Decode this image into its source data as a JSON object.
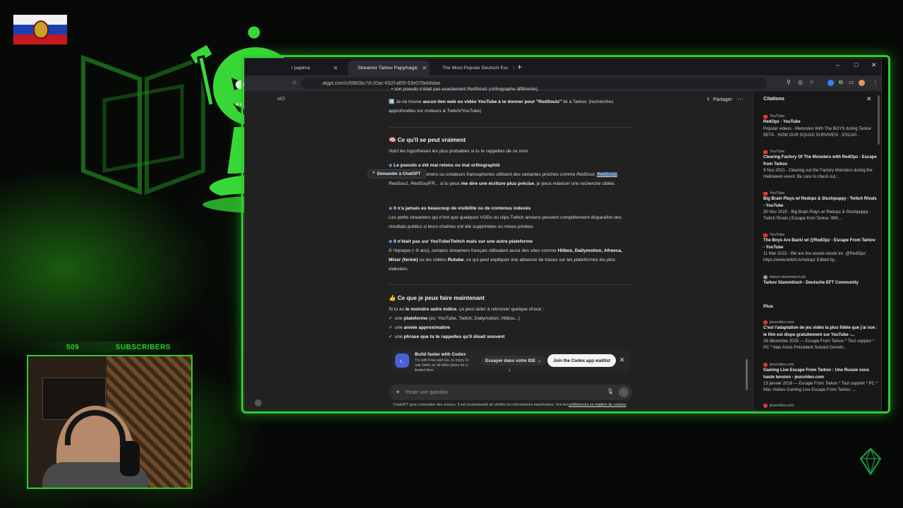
{
  "overlay": {
    "subscriber_count": "509",
    "subscriber_label": "SUBSCRIBERS",
    "accent_color": "#2bd12b"
  },
  "browser": {
    "tabs": [
      {
        "label": "r papima",
        "active": false
      },
      {
        "label": "Streamer Tarkov Papymagic",
        "active": true
      },
      {
        "label": "The Most Popular Deutsch Esc",
        "active": false
      }
    ],
    "url": "atgpt.com/c/6982bc7d-20ac-832f-af05-53e070eb6dae",
    "window_controls": [
      "–",
      "□",
      "✕"
    ]
  },
  "chat": {
    "share_label": "Partager",
    "partial_top_text": "son pseudo n'était pas exactement RedSoulz (orthographe différente).",
    "notice": {
      "prefix": "Je ne trouve ",
      "bold": "aucun lien web ou vidéo YouTube à te donner pour \"RedSoulz\"",
      "rest": " lié à Tarkov. (recherches approfondies sur moteurs & Twitch/YouTube)"
    },
    "section1_title": "Ce qu'il se peut vraiment",
    "section1_intro": "Voici les hypothèses les plus probables si tu te rappelles de ce nom :",
    "h1_title": "Le pseudo a été mal retenu ou mal orthographié",
    "h1_text_a": "Beaucoup de streamers ou créateurs francophones utilisent des variantes proches comme ",
    "h1_variants_a": "RedSoul,",
    "h1_variant_highlight": "RedSoulz",
    "h1_variants_b": ", RedSou1, RedSoulFR",
    "h1_text_b": "... si tu peux ",
    "h1_bold": "me dire une écriture plus précise",
    "h1_text_c": ", je peux relancer une recherche ciblée.",
    "ask_popup": "Demander à ChatGPT",
    "h2_title": "Il n'a jamais eu beaucoup de visibilité ou de contenus indexés",
    "h2_text": "Les petits streamers qui n'ont que quelques VODs ou clips Twitch anciens peuvent complètement disparaître des résultats publics si leurs chaînes ont été supprimées ou mises privées.",
    "h3_title": "Il n'était pas sur YouTube/Twitch mais sur une autre plateforme",
    "h3_text_a": "À l'époque (~8 ans), certains streamers français utilisaient aussi des sites comme ",
    "h3_sites": "Hitbox, Dailymotion, Afreeca, Mixer (fermé)",
    "h3_text_b": " ou les vidéos ",
    "h3_rutube": "Rutube",
    "h3_text_c": ", ce qui peut expliquer une absence de traces ",
    "h3_italic": "sur les plateformes les plus indexées.",
    "section2_title": "Ce que je peux faire maintenant",
    "section2_intro_a": "Si tu as ",
    "section2_intro_bold": "le moindre autre indice",
    "section2_intro_b": ", ça peut aider à retrouver quelque chose :",
    "checklist": [
      {
        "a": "une ",
        "b": "plateforme",
        "c": " (ex: YouTube, Twitch, Dailymotion, Hitbox...)"
      },
      {
        "a": "une ",
        "b": "année approximative",
        "c": ""
      },
      {
        "a": "une ",
        "b": "phrase que tu te rappelles qu'il disait souvent",
        "c": ""
      }
    ]
  },
  "codex": {
    "title": "Build faster with Codex",
    "description": "Try with Free and Go, or enjoy 2x rate limits on all other plans for a limited time.",
    "ide_label": "Essayer dans votre IDE",
    "join_label": "Join the Codex app waitlist"
  },
  "composer": {
    "placeholder": "Poser une question",
    "disclaimer_a": "ChatGPT peut commettre des erreurs. Il est recommandé de vérifier les informations importantes. Voir les ",
    "disclaimer_link": "préférences en matière de cookies",
    "disclaimer_b": "."
  },
  "citations": {
    "title": "Citations",
    "more_label": "Plus",
    "items": [
      {
        "source": "YouTube",
        "title": "RedOpz - YouTube",
        "snippet": "Popular videos - Memories With The BOYS during Tarkov BETA · HOW OUR SQUAD SURVIVES! · ESCAP..."
      },
      {
        "source": "YouTube",
        "title": "Clearing Factory Of The Monsters with RedOpz - Escape from Tarkov",
        "snippet": "9 Nov 2021 - Clearing out the Factory Monsters during the Halloween event. Be sure to check out..."
      },
      {
        "source": "YouTube",
        "title": "Big Brain Plays w/ Redopz & Slushpuppy - Twitch Rivals - YouTube",
        "snippet": "30 Nov 2020 - Big Brain Plays w/ Redopz & Slushpuppy - Twitch Rivals | Escape from Tarkov. 99K..."
      },
      {
        "source": "YouTube",
        "title": "The Boys Are Back! w/ @RedOpz - Escape From Tarkov - YouTube",
        "snippet": "11 Mar 2022 - We are the woods doods tm. @RedOpz: https://www.twitch.tv/redopz Edited by..."
      },
      {
        "source": "tarkov-stammtisch.de",
        "title": "Tarkov Stammtisch - Deutsche EFT Community",
        "snippet": ""
      }
    ],
    "more_items": [
      {
        "source": "jeuxvideo.com",
        "title": "C'est l'adaptation de jeu vidéo la plus fidèle que j'ai vue : le film est dispo gratuitement sur YouTube -...",
        "snippet": "28 décembre 2025 — Escape From Tarkov * Tout support * PC * Mac Actus Précédent Suivant Dernièr..."
      },
      {
        "source": "jeuxvideo.com",
        "title": "Gaming Live Escape From Tarkov : Une Russie sous haute tension - jeuxvideo.com",
        "snippet": "13 janvier 2018 — Escape From Tarkov * Tout support * PC * Mac Vidéos Gaming Live Escape From Tarkov :..."
      },
      {
        "source": "jeuxvideo.com",
        "title": "",
        "snippet": ""
      }
    ]
  }
}
